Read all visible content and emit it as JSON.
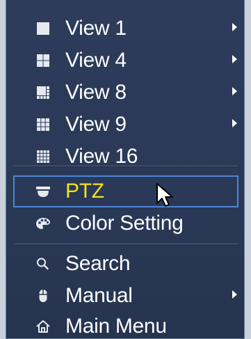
{
  "menu": {
    "items": [
      {
        "label": "View 1",
        "icon": "view-1-icon",
        "has_submenu": true
      },
      {
        "label": "View 4",
        "icon": "view-4-icon",
        "has_submenu": true
      },
      {
        "label": "View 8",
        "icon": "view-8-icon",
        "has_submenu": true
      },
      {
        "label": "View 9",
        "icon": "view-9-icon",
        "has_submenu": true
      },
      {
        "label": "View 16",
        "icon": "view-16-icon",
        "has_submenu": false
      },
      {
        "label": "PTZ",
        "icon": "ptz-camera-icon",
        "has_submenu": false,
        "highlighted": true
      },
      {
        "label": "Color Setting",
        "icon": "palette-icon",
        "has_submenu": false
      },
      {
        "label": "Search",
        "icon": "search-icon",
        "has_submenu": false
      },
      {
        "label": "Manual",
        "icon": "mouse-icon",
        "has_submenu": true
      },
      {
        "label": "Main Menu",
        "icon": "home-icon",
        "has_submenu": false
      }
    ]
  },
  "colors": {
    "background": "#2a3957",
    "text": "#ffffff",
    "highlight_text": "#f1e223",
    "highlight_border": "#4c86d6"
  }
}
